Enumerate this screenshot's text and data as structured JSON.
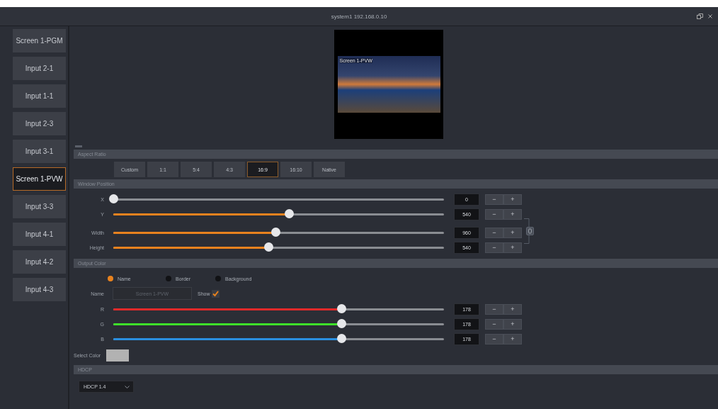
{
  "window": {
    "title": "system1 192.168.0.10"
  },
  "sources": [
    {
      "label": "Screen 1-PGM",
      "selected": false
    },
    {
      "label": "Input 2-1",
      "selected": false
    },
    {
      "label": "Input 1-1",
      "selected": false
    },
    {
      "label": "Input 2-3",
      "selected": false
    },
    {
      "label": "Input 3-1",
      "selected": false
    },
    {
      "label": "Screen 1-PVW",
      "selected": true
    },
    {
      "label": "Input 3-3",
      "selected": false
    },
    {
      "label": "Input 4-1",
      "selected": false
    },
    {
      "label": "Input 4-2",
      "selected": false
    },
    {
      "label": "Input 4-3",
      "selected": false
    }
  ],
  "preview": {
    "overlay_label": "Screen 1-PVW"
  },
  "aspect_ratio": {
    "header": "Aspect Ratio",
    "options": [
      {
        "label": "Custom",
        "selected": false
      },
      {
        "label": "1:1",
        "selected": false
      },
      {
        "label": "5:4",
        "selected": false
      },
      {
        "label": "4:3",
        "selected": false
      },
      {
        "label": "16:9",
        "selected": true
      },
      {
        "label": "16:10",
        "selected": false
      },
      {
        "label": "Native",
        "selected": false
      }
    ]
  },
  "window_position": {
    "header": "Window Position",
    "rows": [
      {
        "label": "X",
        "level": 0,
        "value": "0",
        "decrement": "−",
        "increment": "+"
      },
      {
        "label": "Y",
        "level": 0.53,
        "value": "540",
        "color": "#e8821e",
        "decrement": "−",
        "increment": "+"
      },
      {
        "label": "Width",
        "level": 0.49,
        "value": "960",
        "color": "#e8821e",
        "decrement": "−",
        "increment": "+"
      },
      {
        "label": "Height",
        "level": 0.47,
        "value": "540",
        "color": "#e8821e",
        "decrement": "−",
        "increment": "+"
      }
    ]
  },
  "output_color": {
    "header": "Output Color",
    "targets": [
      {
        "label": "Name",
        "selected": true
      },
      {
        "label": "Border",
        "selected": false
      },
      {
        "label": "Background",
        "selected": false
      }
    ],
    "name_label": "Name",
    "name_value": "Screen 1-PVW",
    "show_label": "Show",
    "show_checked": true,
    "channels": [
      {
        "label": "R",
        "level": 0.69,
        "value": "178",
        "color": "#e02a2a",
        "decrement": "−",
        "increment": "+"
      },
      {
        "label": "G",
        "level": 0.69,
        "value": "178",
        "color": "#3ee02a",
        "decrement": "−",
        "increment": "+"
      },
      {
        "label": "B",
        "level": 0.69,
        "value": "178",
        "color": "#2a8fe0",
        "decrement": "−",
        "increment": "+"
      }
    ],
    "select_color": {
      "label": "Select Color",
      "color": "#b2b2b2"
    }
  },
  "hdcp": {
    "header": "HDCP",
    "value": "HDCP 1.4"
  }
}
